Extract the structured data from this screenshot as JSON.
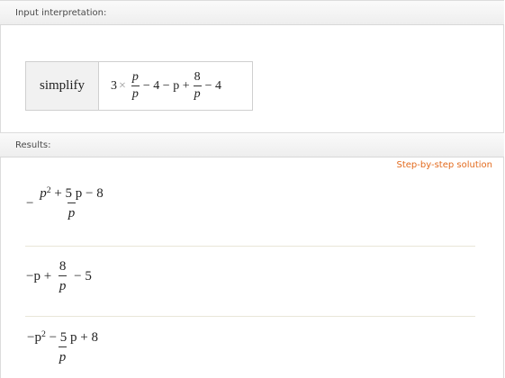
{
  "pods": {
    "input_title": "Input interpretation:",
    "results_title": "Results:"
  },
  "input": {
    "label": "simplify",
    "expr": {
      "coef": "3",
      "times": "×",
      "frac1_num": "p",
      "frac1_den": "p",
      "mid": "− 4 − p +",
      "frac2_num": "8",
      "frac2_den": "p",
      "tail": "− 4"
    }
  },
  "step_by_step": "Step-by-step solution",
  "results": [
    {
      "sign": "−",
      "num": "p² + 5 p − 8",
      "num_var": "p",
      "num_exp": "2",
      "num_rest": "+ 5 p − 8",
      "den": "p"
    },
    {
      "lead": "−p +",
      "frac_num": "8",
      "frac_den": "p",
      "tail": "− 5"
    },
    {
      "num_pre": "−p",
      "num_exp": "2",
      "num_rest": "− 5 p + 8",
      "den": "p"
    }
  ],
  "colors": {
    "link": "#e36b1e",
    "separator": "#e9e6d8",
    "header_bg": "#eeeeee"
  }
}
